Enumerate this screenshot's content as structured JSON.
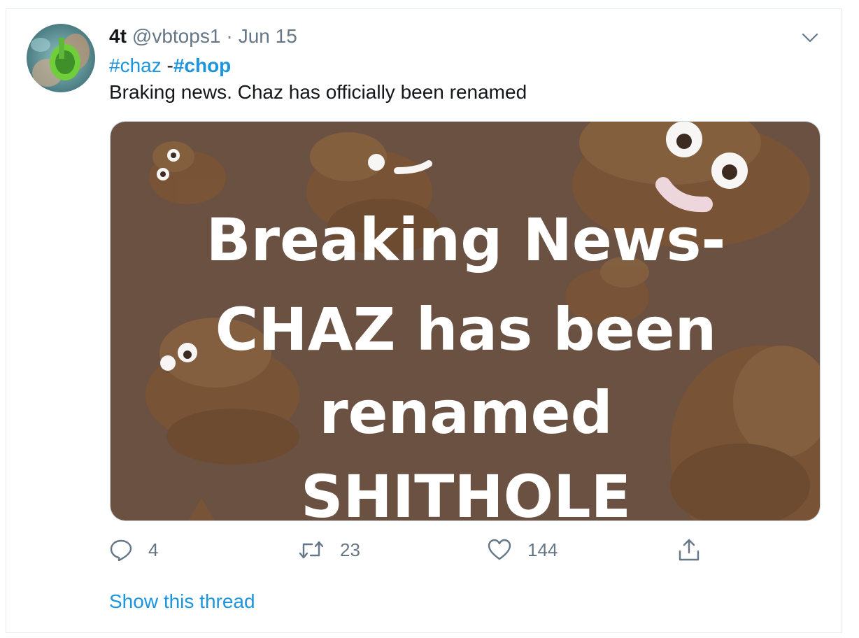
{
  "tweet": {
    "display_name": "4t",
    "handle": "@vbtops1",
    "separator": "·",
    "date": "Jun 15",
    "hashtag_1": "#chaz",
    "hashtag_sep": " -",
    "hashtag_2": "#chop",
    "text": "Braking news. Chaz has officially been renamed"
  },
  "media": {
    "line_1": "Breaking News-",
    "line_2": "CHAZ has been",
    "line_3": "renamed",
    "line_4": "SHITHOLE",
    "background_color": "#6b5142",
    "emoji_color": "#7a5436"
  },
  "actions": {
    "reply_count": "4",
    "retweet_count": "23",
    "like_count": "144"
  },
  "footer": {
    "show_thread_label": "Show this thread"
  },
  "colors": {
    "link": "#1b95e0",
    "secondary_text": "#657786",
    "primary_text": "#14171a"
  },
  "icons": [
    "reply-icon",
    "retweet-icon",
    "like-icon",
    "share-icon",
    "chevron-down-icon"
  ]
}
